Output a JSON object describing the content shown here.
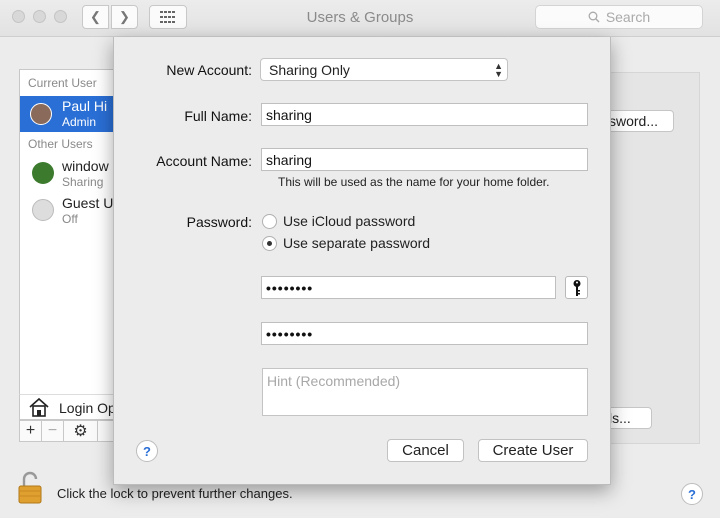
{
  "window": {
    "title": "Users & Groups"
  },
  "search": {
    "placeholder": "Search"
  },
  "sidebar": {
    "current_user_header": "Current User",
    "other_users_header": "Other Users",
    "users": [
      {
        "name": "Paul Hi",
        "role": "Admin"
      },
      {
        "name": "window",
        "role": "Sharing"
      },
      {
        "name": "Guest U",
        "role": "Off"
      }
    ],
    "login_options": "Login Op"
  },
  "background": {
    "password_button": "sword...",
    "options_button": "ls...",
    "lock_text": "Click the lock to prevent further changes."
  },
  "sheet": {
    "new_account_label": "New Account:",
    "new_account_value": "Sharing Only",
    "full_name_label": "Full Name:",
    "full_name_value": "sharing",
    "account_name_label": "Account Name:",
    "account_name_value": "sharing",
    "account_name_note": "This will be used as the name for your home folder.",
    "password_label": "Password:",
    "radio_icloud": "Use iCloud password",
    "radio_separate": "Use separate password",
    "password_masked": "••••••••",
    "verify_masked": "••••••••",
    "hint_placeholder": "Hint (Recommended)",
    "cancel": "Cancel",
    "create": "Create User"
  },
  "colors": {
    "selection": "#2a6fd6",
    "help": "#2a6fd6"
  }
}
